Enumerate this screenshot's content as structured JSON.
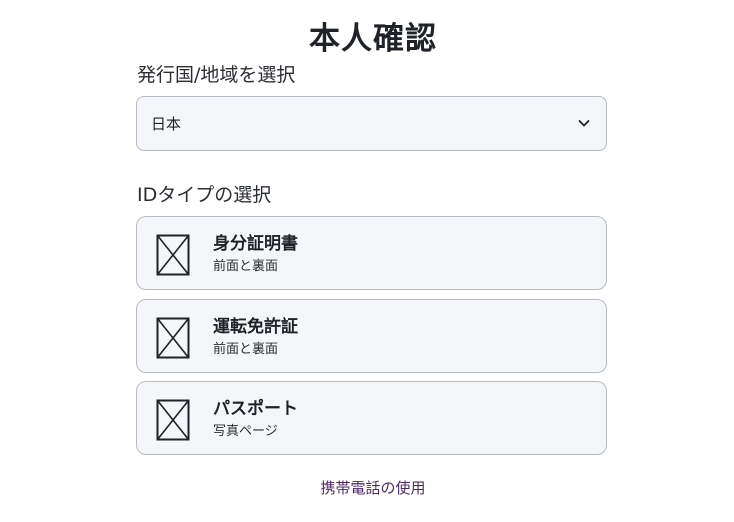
{
  "page": {
    "title": "本人確認"
  },
  "country": {
    "label": "発行国/地域を選択",
    "selected": "日本"
  },
  "id_type": {
    "label": "IDタイプの選択",
    "options": [
      {
        "name": "身分証明書",
        "description": "前面と裏面",
        "icon": "document-placeholder-icon"
      },
      {
        "name": "運転免許証",
        "description": "前面と裏面",
        "icon": "document-placeholder-icon"
      },
      {
        "name": "パスポート",
        "description": "写真ページ",
        "icon": "document-placeholder-icon"
      }
    ]
  },
  "footer": {
    "mobile_link": "携帯電話の使用"
  },
  "colors": {
    "card_background": "#f5f6f9",
    "card_border": "#b7bcc2",
    "link": "#4b2a66",
    "text": "#1f2328"
  }
}
